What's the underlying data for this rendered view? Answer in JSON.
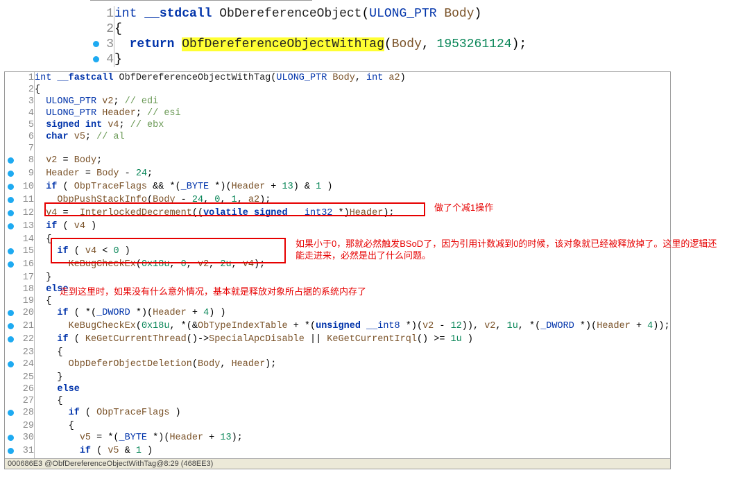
{
  "top_code": {
    "lines": [
      {
        "n": 1,
        "bp": false,
        "tokens": [
          {
            "t": "int ",
            "c": "type"
          },
          {
            "t": "__stdcall ",
            "c": "kw"
          },
          {
            "t": "ObDereferenceObject",
            "c": "fn"
          },
          {
            "t": "(",
            "c": ""
          },
          {
            "t": "ULONG_PTR ",
            "c": "type"
          },
          {
            "t": "Body",
            "c": "var"
          },
          {
            "t": ")",
            "c": ""
          }
        ]
      },
      {
        "n": 2,
        "bp": false,
        "tokens": [
          {
            "t": "{",
            "c": ""
          }
        ]
      },
      {
        "n": 3,
        "bp": true,
        "tokens": [
          {
            "t": "  ",
            "c": ""
          },
          {
            "t": "return ",
            "c": "kw"
          },
          {
            "t": "ObfDereferenceObjectWithTag",
            "c": "fn",
            "hl": true
          },
          {
            "t": "(",
            "c": ""
          },
          {
            "t": "Body",
            "c": "var"
          },
          {
            "t": ", ",
            "c": ""
          },
          {
            "t": "1953261124",
            "c": "num"
          },
          {
            "t": ");",
            "c": ""
          }
        ]
      },
      {
        "n": 4,
        "bp": true,
        "tokens": [
          {
            "t": "}",
            "c": ""
          }
        ]
      }
    ]
  },
  "bottom_code": {
    "lines": [
      {
        "n": 1,
        "bp": false,
        "tokens": [
          {
            "t": "int ",
            "c": "type"
          },
          {
            "t": "__fastcall ",
            "c": "kw"
          },
          {
            "t": "ObfDereferenceObjectWithTag",
            "c": "fn"
          },
          {
            "t": "(",
            "c": ""
          },
          {
            "t": "ULONG_PTR ",
            "c": "type"
          },
          {
            "t": "Body",
            "c": "var"
          },
          {
            "t": ", ",
            "c": ""
          },
          {
            "t": "int ",
            "c": "type"
          },
          {
            "t": "a2",
            "c": "var"
          },
          {
            "t": ")",
            "c": ""
          }
        ]
      },
      {
        "n": 2,
        "bp": false,
        "tokens": [
          {
            "t": "{",
            "c": ""
          }
        ]
      },
      {
        "n": 3,
        "bp": false,
        "tokens": [
          {
            "t": "  ",
            "c": ""
          },
          {
            "t": "ULONG_PTR ",
            "c": "type"
          },
          {
            "t": "v2",
            "c": "var"
          },
          {
            "t": "; ",
            "c": ""
          },
          {
            "t": "// edi",
            "c": "comment"
          }
        ]
      },
      {
        "n": 4,
        "bp": false,
        "tokens": [
          {
            "t": "  ",
            "c": ""
          },
          {
            "t": "ULONG_PTR ",
            "c": "type"
          },
          {
            "t": "Header",
            "c": "var"
          },
          {
            "t": "; ",
            "c": ""
          },
          {
            "t": "// esi",
            "c": "comment"
          }
        ]
      },
      {
        "n": 5,
        "bp": false,
        "tokens": [
          {
            "t": "  ",
            "c": ""
          },
          {
            "t": "signed int ",
            "c": "kw"
          },
          {
            "t": "v4",
            "c": "var"
          },
          {
            "t": "; ",
            "c": ""
          },
          {
            "t": "// ebx",
            "c": "comment"
          }
        ]
      },
      {
        "n": 6,
        "bp": false,
        "tokens": [
          {
            "t": "  ",
            "c": ""
          },
          {
            "t": "char ",
            "c": "kw"
          },
          {
            "t": "v5",
            "c": "var"
          },
          {
            "t": "; ",
            "c": ""
          },
          {
            "t": "// al",
            "c": "comment"
          }
        ]
      },
      {
        "n": 7,
        "bp": false,
        "tokens": [
          {
            "t": "",
            "c": ""
          }
        ]
      },
      {
        "n": 8,
        "bp": true,
        "tokens": [
          {
            "t": "  ",
            "c": ""
          },
          {
            "t": "v2 ",
            "c": "var"
          },
          {
            "t": "= ",
            "c": ""
          },
          {
            "t": "Body",
            "c": "var"
          },
          {
            "t": ";",
            "c": ""
          }
        ]
      },
      {
        "n": 9,
        "bp": true,
        "tokens": [
          {
            "t": "  ",
            "c": ""
          },
          {
            "t": "Header ",
            "c": "var"
          },
          {
            "t": "= ",
            "c": ""
          },
          {
            "t": "Body ",
            "c": "var"
          },
          {
            "t": "- ",
            "c": ""
          },
          {
            "t": "24",
            "c": "num"
          },
          {
            "t": ";",
            "c": ""
          }
        ]
      },
      {
        "n": 10,
        "bp": true,
        "tokens": [
          {
            "t": "  ",
            "c": ""
          },
          {
            "t": "if ",
            "c": "kw"
          },
          {
            "t": "( ",
            "c": ""
          },
          {
            "t": "ObpTraceFlags ",
            "c": "var"
          },
          {
            "t": "&& *(",
            "c": ""
          },
          {
            "t": "_BYTE ",
            "c": "type"
          },
          {
            "t": "*)(",
            "c": ""
          },
          {
            "t": "Header ",
            "c": "var"
          },
          {
            "t": "+ ",
            "c": ""
          },
          {
            "t": "13",
            "c": "num"
          },
          {
            "t": ") & ",
            "c": ""
          },
          {
            "t": "1",
            "c": "num"
          },
          {
            "t": " )",
            "c": ""
          }
        ]
      },
      {
        "n": 11,
        "bp": true,
        "tokens": [
          {
            "t": "    ",
            "c": ""
          },
          {
            "t": "ObpPushStackInfo",
            "c": "fn-call"
          },
          {
            "t": "(",
            "c": ""
          },
          {
            "t": "Body ",
            "c": "var"
          },
          {
            "t": "- ",
            "c": ""
          },
          {
            "t": "24",
            "c": "num"
          },
          {
            "t": ", ",
            "c": ""
          },
          {
            "t": "0",
            "c": "num"
          },
          {
            "t": ", ",
            "c": ""
          },
          {
            "t": "1",
            "c": "num"
          },
          {
            "t": ", ",
            "c": ""
          },
          {
            "t": "a2",
            "c": "var"
          },
          {
            "t": ");",
            "c": ""
          }
        ]
      },
      {
        "n": 12,
        "bp": true,
        "tokens": [
          {
            "t": "  ",
            "c": ""
          },
          {
            "t": "v4 ",
            "c": "var"
          },
          {
            "t": "= ",
            "c": ""
          },
          {
            "t": "_InterlockedDecrement",
            "c": "fn-call"
          },
          {
            "t": "((",
            "c": ""
          },
          {
            "t": "volatile signed ",
            "c": "kw"
          },
          {
            "t": "__int32 ",
            "c": "type"
          },
          {
            "t": "*)",
            "c": ""
          },
          {
            "t": "Header",
            "c": "var"
          },
          {
            "t": ");",
            "c": ""
          }
        ]
      },
      {
        "n": 13,
        "bp": true,
        "tokens": [
          {
            "t": "  ",
            "c": ""
          },
          {
            "t": "if ",
            "c": "kw"
          },
          {
            "t": "( ",
            "c": ""
          },
          {
            "t": "v4",
            "c": "var"
          },
          {
            "t": " )",
            "c": ""
          }
        ]
      },
      {
        "n": 14,
        "bp": false,
        "tokens": [
          {
            "t": "  {",
            "c": ""
          }
        ]
      },
      {
        "n": 15,
        "bp": true,
        "tokens": [
          {
            "t": "    ",
            "c": ""
          },
          {
            "t": "if ",
            "c": "kw"
          },
          {
            "t": "( ",
            "c": ""
          },
          {
            "t": "v4 ",
            "c": "var"
          },
          {
            "t": "< ",
            "c": ""
          },
          {
            "t": "0",
            "c": "num"
          },
          {
            "t": " )",
            "c": ""
          }
        ]
      },
      {
        "n": 16,
        "bp": true,
        "tokens": [
          {
            "t": "      ",
            "c": ""
          },
          {
            "t": "KeBugCheckEx",
            "c": "fn-call"
          },
          {
            "t": "(",
            "c": ""
          },
          {
            "t": "0x18u",
            "c": "num"
          },
          {
            "t": ", ",
            "c": ""
          },
          {
            "t": "0",
            "c": "num"
          },
          {
            "t": ", ",
            "c": ""
          },
          {
            "t": "v2",
            "c": "var"
          },
          {
            "t": ", ",
            "c": ""
          },
          {
            "t": "2u",
            "c": "num"
          },
          {
            "t": ", ",
            "c": ""
          },
          {
            "t": "v4",
            "c": "var"
          },
          {
            "t": ");",
            "c": ""
          }
        ]
      },
      {
        "n": 17,
        "bp": false,
        "tokens": [
          {
            "t": "  }",
            "c": ""
          }
        ]
      },
      {
        "n": 18,
        "bp": false,
        "tokens": [
          {
            "t": "  ",
            "c": ""
          },
          {
            "t": "else",
            "c": "kw"
          }
        ]
      },
      {
        "n": 19,
        "bp": false,
        "tokens": [
          {
            "t": "  {",
            "c": ""
          }
        ]
      },
      {
        "n": 20,
        "bp": true,
        "tokens": [
          {
            "t": "    ",
            "c": ""
          },
          {
            "t": "if ",
            "c": "kw"
          },
          {
            "t": "( *(",
            "c": ""
          },
          {
            "t": "_DWORD ",
            "c": "type"
          },
          {
            "t": "*)(",
            "c": ""
          },
          {
            "t": "Header ",
            "c": "var"
          },
          {
            "t": "+ ",
            "c": ""
          },
          {
            "t": "4",
            "c": "num"
          },
          {
            "t": ") )",
            "c": ""
          }
        ]
      },
      {
        "n": 21,
        "bp": true,
        "tokens": [
          {
            "t": "      ",
            "c": ""
          },
          {
            "t": "KeBugCheckEx",
            "c": "fn-call"
          },
          {
            "t": "(",
            "c": ""
          },
          {
            "t": "0x18u",
            "c": "num"
          },
          {
            "t": ", *(&",
            "c": ""
          },
          {
            "t": "ObTypeIndexTable ",
            "c": "var"
          },
          {
            "t": "+ *(",
            "c": ""
          },
          {
            "t": "unsigned ",
            "c": "kw"
          },
          {
            "t": "__int8 ",
            "c": "type"
          },
          {
            "t": "*)(",
            "c": ""
          },
          {
            "t": "v2 ",
            "c": "var"
          },
          {
            "t": "- ",
            "c": ""
          },
          {
            "t": "12",
            "c": "num"
          },
          {
            "t": ")), ",
            "c": ""
          },
          {
            "t": "v2",
            "c": "var"
          },
          {
            "t": ", ",
            "c": ""
          },
          {
            "t": "1u",
            "c": "num"
          },
          {
            "t": ", *(",
            "c": ""
          },
          {
            "t": "_DWORD ",
            "c": "type"
          },
          {
            "t": "*)(",
            "c": ""
          },
          {
            "t": "Header ",
            "c": "var"
          },
          {
            "t": "+ ",
            "c": ""
          },
          {
            "t": "4",
            "c": "num"
          },
          {
            "t": "));",
            "c": ""
          }
        ]
      },
      {
        "n": 22,
        "bp": true,
        "tokens": [
          {
            "t": "    ",
            "c": ""
          },
          {
            "t": "if ",
            "c": "kw"
          },
          {
            "t": "( ",
            "c": ""
          },
          {
            "t": "KeGetCurrentThread",
            "c": "fn-call"
          },
          {
            "t": "()->",
            "c": ""
          },
          {
            "t": "SpecialApcDisable ",
            "c": "var"
          },
          {
            "t": "|| ",
            "c": ""
          },
          {
            "t": "KeGetCurrentIrql",
            "c": "fn-call"
          },
          {
            "t": "() >= ",
            "c": ""
          },
          {
            "t": "1u",
            "c": "num"
          },
          {
            "t": " )",
            "c": ""
          }
        ]
      },
      {
        "n": 23,
        "bp": false,
        "tokens": [
          {
            "t": "    {",
            "c": ""
          }
        ]
      },
      {
        "n": 24,
        "bp": true,
        "tokens": [
          {
            "t": "      ",
            "c": ""
          },
          {
            "t": "ObpDeferObjectDeletion",
            "c": "fn-call"
          },
          {
            "t": "(",
            "c": ""
          },
          {
            "t": "Body",
            "c": "var"
          },
          {
            "t": ", ",
            "c": ""
          },
          {
            "t": "Header",
            "c": "var"
          },
          {
            "t": ");",
            "c": ""
          }
        ]
      },
      {
        "n": 25,
        "bp": false,
        "tokens": [
          {
            "t": "    }",
            "c": ""
          }
        ]
      },
      {
        "n": 26,
        "bp": false,
        "tokens": [
          {
            "t": "    ",
            "c": ""
          },
          {
            "t": "else",
            "c": "kw"
          }
        ]
      },
      {
        "n": 27,
        "bp": false,
        "tokens": [
          {
            "t": "    {",
            "c": ""
          }
        ]
      },
      {
        "n": 28,
        "bp": true,
        "tokens": [
          {
            "t": "      ",
            "c": ""
          },
          {
            "t": "if ",
            "c": "kw"
          },
          {
            "t": "( ",
            "c": ""
          },
          {
            "t": "ObpTraceFlags",
            "c": "var"
          },
          {
            "t": " )",
            "c": ""
          }
        ]
      },
      {
        "n": 29,
        "bp": false,
        "tokens": [
          {
            "t": "      {",
            "c": ""
          }
        ]
      },
      {
        "n": 30,
        "bp": true,
        "tokens": [
          {
            "t": "        ",
            "c": ""
          },
          {
            "t": "v5 ",
            "c": "var"
          },
          {
            "t": "= *(",
            "c": ""
          },
          {
            "t": "_BYTE ",
            "c": "type"
          },
          {
            "t": "*)(",
            "c": ""
          },
          {
            "t": "Header ",
            "c": "var"
          },
          {
            "t": "+ ",
            "c": ""
          },
          {
            "t": "13",
            "c": "num"
          },
          {
            "t": ");",
            "c": ""
          }
        ]
      },
      {
        "n": 31,
        "bp": true,
        "tokens": [
          {
            "t": "        ",
            "c": ""
          },
          {
            "t": "if ",
            "c": "kw"
          },
          {
            "t": "( ",
            "c": ""
          },
          {
            "t": "v5 ",
            "c": "var"
          },
          {
            "t": "& ",
            "c": ""
          },
          {
            "t": "1",
            "c": "num"
          },
          {
            "t": " )",
            "c": ""
          }
        ]
      }
    ]
  },
  "status": "000686E3 @ObfDereferenceObjectWithTag@8:29 (468EE3)",
  "annotations": {
    "a1": "做了个减1操作",
    "a2": "如果小于0，那就必然触发BSoD了，因为引用计数减到0的时候，该对象就已经被释放掉了。这里的逻辑还能走进来，必然是出了什么问题。",
    "a3": "走到这里时，如果没有什么意外情况，基本就是释放对象所占据的系统内存了"
  }
}
